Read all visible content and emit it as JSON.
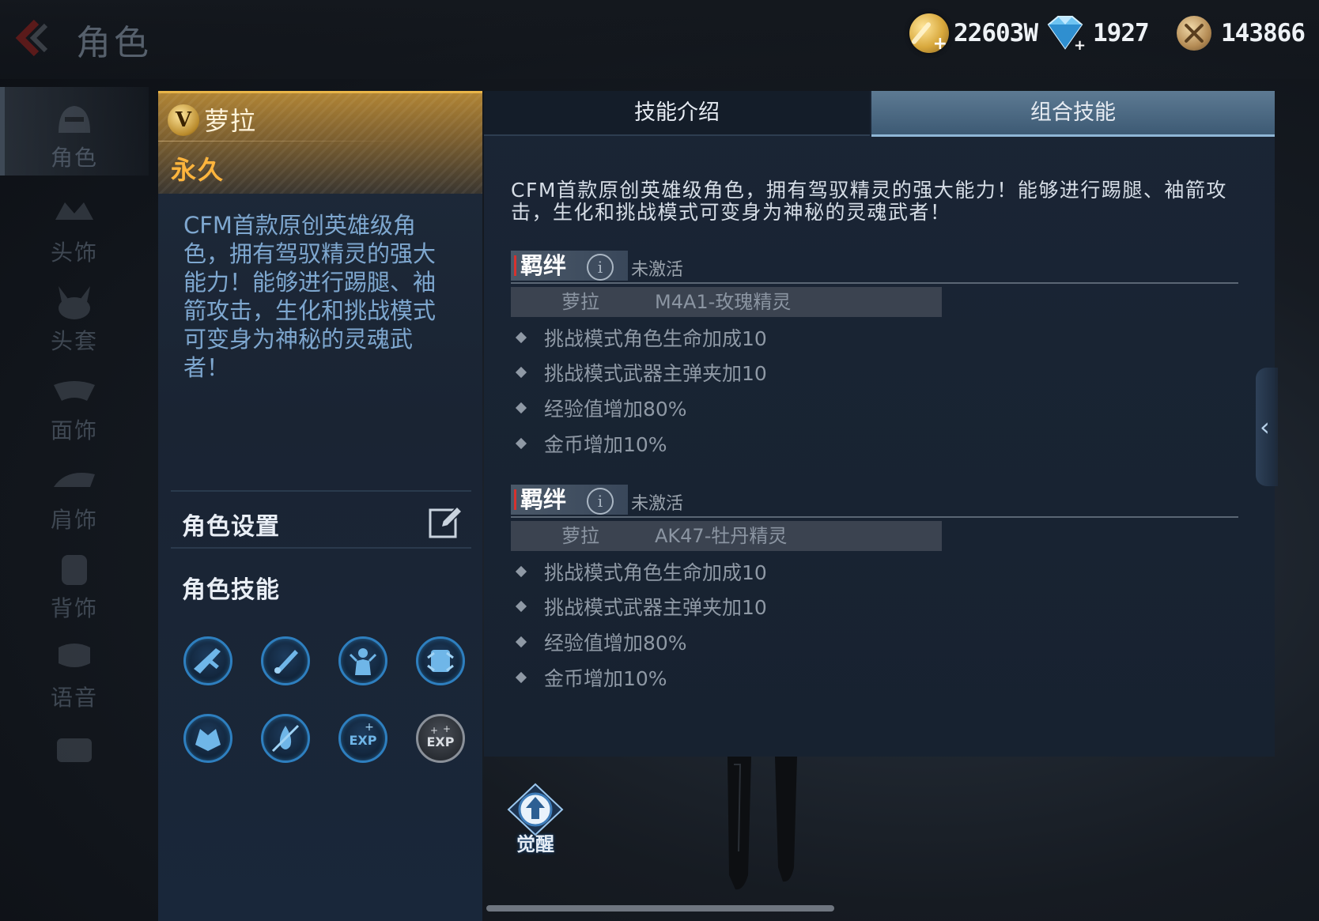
{
  "header": {
    "title": "角色",
    "currencies": [
      {
        "icon": "gold-coin-icon",
        "amount": "22603W"
      },
      {
        "icon": "diamond-icon",
        "amount": "1927"
      },
      {
        "icon": "honor-coin-icon",
        "amount": "143866"
      }
    ]
  },
  "sidebar": {
    "items": [
      {
        "label": "角色",
        "icon": "character-icon",
        "active": true
      },
      {
        "label": "头饰",
        "icon": "headwear-icon",
        "active": false
      },
      {
        "label": "头套",
        "icon": "headgear-icon",
        "active": false
      },
      {
        "label": "面饰",
        "icon": "face-accessory-icon",
        "active": false
      },
      {
        "label": "肩饰",
        "icon": "shoulder-accessory-icon",
        "active": false
      },
      {
        "label": "背饰",
        "icon": "back-accessory-icon",
        "active": false
      },
      {
        "label": "语音",
        "icon": "voice-icon",
        "active": false
      }
    ]
  },
  "character": {
    "name": "萝拉",
    "vip_letter": "V",
    "duration": "永久",
    "description": "CFM首款原创英雄级角色，拥有驾驭精灵的强大能力！能够进行踢腿、袖箭攻击，生化和挑战模式可变身为神秘的灵魂武者！",
    "settings_label": "角色设置",
    "skills_label": "角色技能",
    "skills": [
      {
        "icon": "rifle-skill-icon"
      },
      {
        "icon": "knife-skill-icon"
      },
      {
        "icon": "soldier-skill-icon"
      },
      {
        "icon": "transform-skill-icon"
      },
      {
        "icon": "beast-skill-icon"
      },
      {
        "icon": "no-bleed-skill-icon"
      },
      {
        "icon": "exp-boost-skill-icon"
      },
      {
        "icon": "exp-bonus-skill-icon"
      }
    ]
  },
  "tabs": [
    {
      "label": "技能介绍",
      "active": false
    },
    {
      "label": "组合技能",
      "active": true
    }
  ],
  "combo": {
    "description": "CFM首款原创英雄级角色，拥有驾驭精灵的强大能力！能够进行踢腿、袖箭攻击，生化和挑战模式可变身为神秘的灵魂武者！",
    "bonds": [
      {
        "label": "羁绊",
        "status": "未激活",
        "character": "萝拉",
        "weapon": "M4A1-玫瑰精灵",
        "effects": [
          "挑战模式角色生命加成10",
          "挑战模式武器主弹夹加10",
          "经验值增加80%",
          "金币增加10%"
        ]
      },
      {
        "label": "羁绊",
        "status": "未激活",
        "character": "萝拉",
        "weapon": "AK47-牡丹精灵",
        "effects": [
          "挑战模式角色生命加成10",
          "挑战模式武器主弹夹加10",
          "经验值增加80%",
          "金币增加10%"
        ]
      }
    ]
  },
  "awaken": {
    "label": "觉醒"
  }
}
